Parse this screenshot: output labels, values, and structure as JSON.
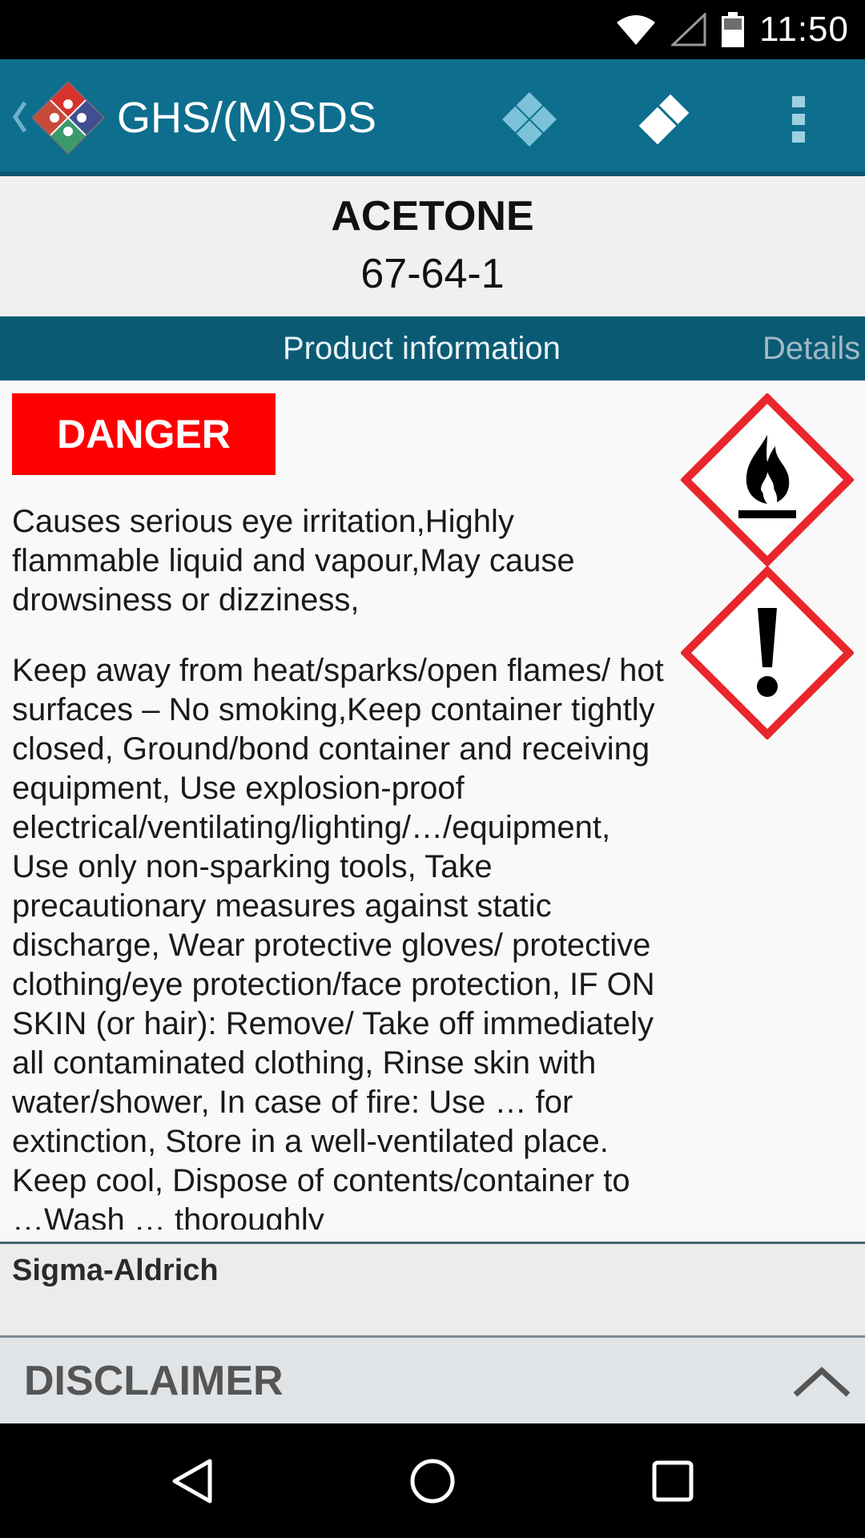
{
  "status_bar": {
    "time": "11:50",
    "icons": [
      "wifi-icon",
      "cell-signal-icon",
      "battery-icon"
    ]
  },
  "app_bar": {
    "title": "GHS/(M)SDS",
    "actions": [
      "diamond-icon",
      "double-diamond-icon",
      "overflow-menu-icon"
    ],
    "color": "#0e6e8e"
  },
  "chemical": {
    "name": "ACETONE",
    "cas": "67-64-1"
  },
  "tabs": {
    "active": "Product information",
    "next": "Details"
  },
  "content": {
    "signal_word": "DANGER",
    "signal_color": "#ff0000",
    "hazard_statements": "Causes serious eye irritation,Highly flammable liquid and vapour,May cause drowsiness or dizziness,",
    "precautionary_statements": "Keep away from heat/sparks/open flames/ hot surfaces – No smoking,Keep container tightly closed, Ground/bond container and receiving equipment, Use explosion-proof electrical/ventilating/lighting/…/equipment, Use only non-sparking tools, Take precautionary measures against static discharge, Wear protective gloves/ protective clothing/eye protection/face protection, IF ON SKIN (or hair): Remove/ Take off immediately all contaminated clothing, Rinse skin with water/shower, In case of fire: Use … for extinction, Store in a well-ventilated place. Keep cool, Dispose of contents/container to …Wash … thoroughly",
    "pictograms": [
      "flame-pictogram-icon",
      "exclamation-pictogram-icon"
    ]
  },
  "supplier": {
    "name": "Sigma-Aldrich"
  },
  "disclaimer": {
    "label": "DISCLAIMER"
  },
  "nav_bar": {
    "buttons": [
      "back-nav-icon",
      "home-nav-icon",
      "recents-nav-icon"
    ]
  }
}
